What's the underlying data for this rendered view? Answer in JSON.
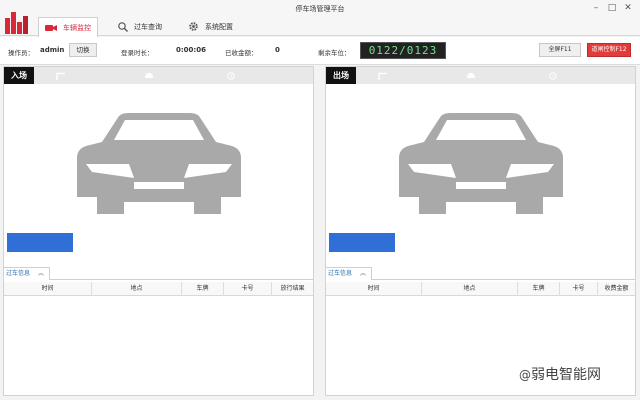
{
  "window": {
    "title": "停车场管理平台",
    "minimize_glyph": "–",
    "maximize_glyph": "□",
    "close_glyph": "✕"
  },
  "tabs": [
    {
      "label": "车辆监控",
      "icon": "camera-icon",
      "active": true
    },
    {
      "label": "过车查询",
      "icon": "search-icon",
      "active": false
    },
    {
      "label": "系统配置",
      "icon": "gear-icon",
      "active": false
    }
  ],
  "info": {
    "operator_label": "操作员：",
    "operator_value": "admin",
    "switch_label": "切换",
    "login_time_label": "登录时长：",
    "login_time_value": "0:00:06",
    "collected_label": "已收金额：",
    "collected_value": "0",
    "spaces_label": "剩余车位：",
    "spaces_value": "0122/0123",
    "fullscreen_label": "全屏F11",
    "gate_control_label": "道闸控制F12"
  },
  "entry": {
    "label": "入场"
  },
  "exit": {
    "label": "出场"
  },
  "entry_grid": {
    "tab_label": "过车信息",
    "columns": [
      "时间",
      "地点",
      "车牌",
      "卡号",
      "放行结果"
    ]
  },
  "exit_grid": {
    "tab_label": "过车信息",
    "columns": [
      "时间",
      "地点",
      "车牌",
      "卡号",
      "收费金额"
    ]
  },
  "watermark": "弱电智能网",
  "colors": {
    "accent_red": "#d8283a",
    "plate_blue": "#2f6fd6",
    "lcd_green": "#78e08a"
  }
}
